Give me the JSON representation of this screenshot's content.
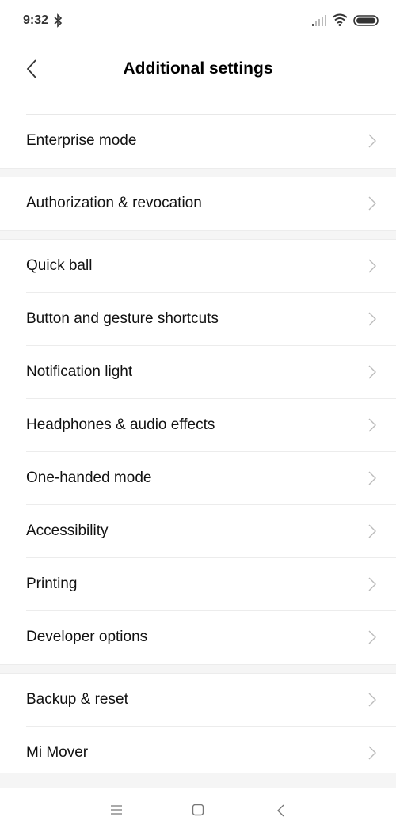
{
  "status_bar": {
    "time": "9:32"
  },
  "header": {
    "title": "Additional settings"
  },
  "groups": [
    {
      "items": [
        {
          "label": "Enterprise mode"
        }
      ]
    },
    {
      "items": [
        {
          "label": "Authorization & revocation"
        }
      ]
    },
    {
      "items": [
        {
          "label": "Quick ball"
        },
        {
          "label": "Button and gesture shortcuts"
        },
        {
          "label": "Notification light"
        },
        {
          "label": "Headphones & audio effects"
        },
        {
          "label": "One-handed mode"
        },
        {
          "label": "Accessibility"
        },
        {
          "label": "Printing"
        },
        {
          "label": "Developer options"
        }
      ]
    },
    {
      "items": [
        {
          "label": "Backup & reset"
        },
        {
          "label": "Mi Mover"
        }
      ]
    }
  ],
  "icons": {
    "bluetooth": "bluetooth-icon",
    "signal": "signal-icon",
    "wifi": "wifi-icon",
    "battery": "battery-icon",
    "back": "chevron-left-icon",
    "row_chevron": "chevron-right-icon",
    "nav_menu": "menu-icon",
    "nav_home": "home-square-icon",
    "nav_back": "back-triangle-icon"
  }
}
